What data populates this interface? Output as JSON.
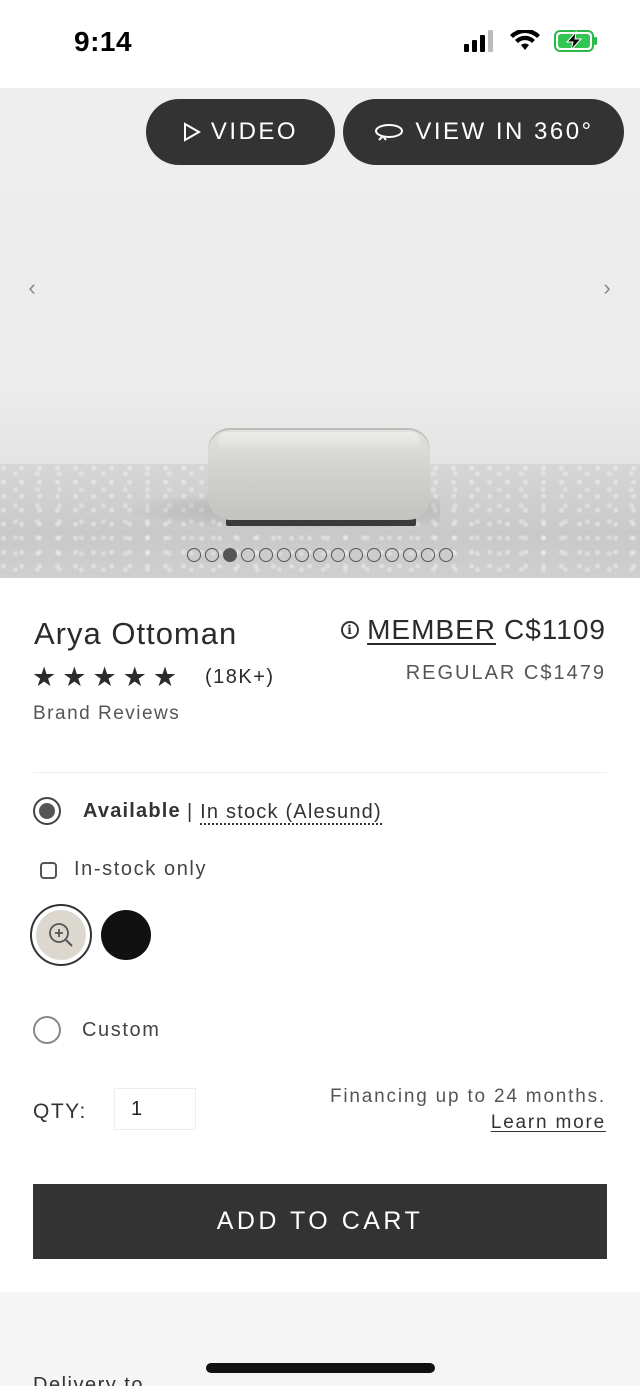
{
  "status_bar": {
    "time": "9:14"
  },
  "hero": {
    "video_label": "VIDEO",
    "view360_label": "VIEW IN 360°",
    "carousel_count": 15,
    "carousel_active_index": 2
  },
  "product": {
    "name": "Arya Ottoman",
    "rating_stars": 5,
    "review_count": "(18K+)",
    "brand_reviews": "Brand Reviews",
    "member_label": "MEMBER",
    "member_price": "C$1109",
    "regular_price": "REGULAR C$1479"
  },
  "options": {
    "available_label": "Available",
    "stock_prefix": "|",
    "stock_link": "In stock (Alesund)",
    "in_stock_only_label": "In-stock only",
    "custom_label": "Custom",
    "swatch_colors": [
      "#dcd8d0",
      "#111111"
    ]
  },
  "purchase": {
    "qty_label": "QTY:",
    "qty_value": "1",
    "financing_text": "Financing up to 24 months.",
    "learn_more": "Learn more",
    "add_to_cart": "ADD TO CART"
  },
  "delivery": {
    "label": "Delivery to"
  }
}
